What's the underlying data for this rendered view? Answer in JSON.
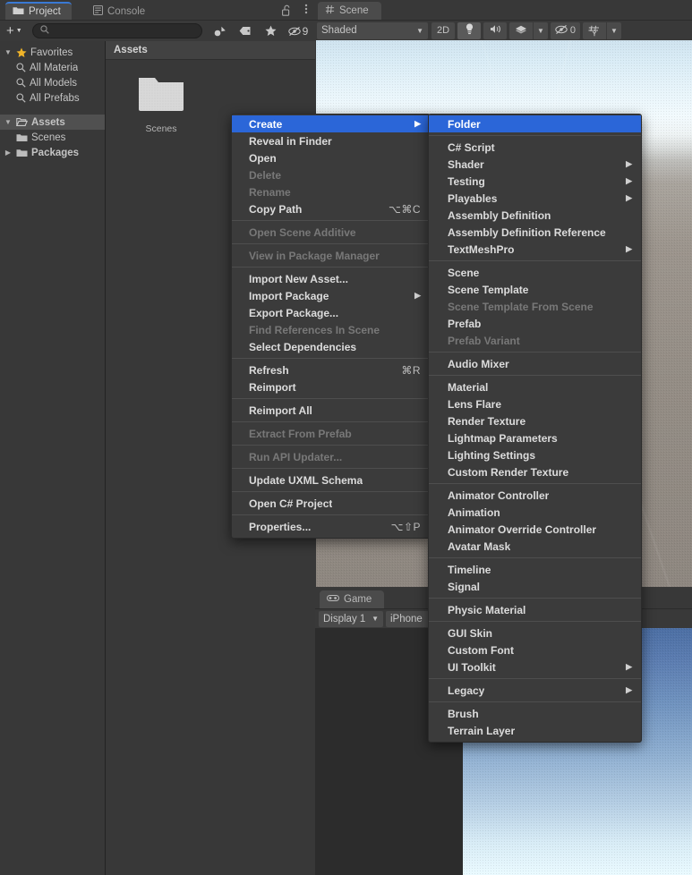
{
  "scene_view": {
    "tab_label": "Scene",
    "tab_icon": "grid-icon",
    "toolbar": {
      "shading_mode": "Shaded",
      "two_d_label": "2D",
      "lighting_icon": "lightbulb-icon",
      "audio_icon": "speaker-icon",
      "fx_icon": "effects-icon",
      "fx_dropdown_icon": "chevron-down-icon",
      "hidden_objects_icon": "eye-off-icon",
      "hidden_objects_count": "0",
      "grid_icon": "grid-visibility-icon",
      "grid_dropdown_icon": "chevron-down-icon",
      "dropdown_icon": "chevron-down-icon"
    }
  },
  "game_view": {
    "tab_label": "Game",
    "tab_icon": "gamepad-icon",
    "toolbar": {
      "display": "Display 1",
      "aspect": "iPhone",
      "dropdown_icon": "chevron-down-icon"
    }
  },
  "project_panel": {
    "tabs": [
      {
        "label": "Project",
        "icon": "folder-icon",
        "selected": true
      },
      {
        "label": "Console",
        "icon": "console-icon",
        "selected": false
      }
    ],
    "lock_icon": "lock-open-icon",
    "menu_icon": "kebab-menu-icon",
    "toolbar": {
      "add_label": "+",
      "add_dropdown_icon": "chevron-down-icon",
      "search_placeholder": "",
      "search_value": "",
      "search_icon": "search-icon",
      "filter_type_icon": "filter-by-type-icon",
      "filter_label_icon": "filter-by-label-icon",
      "favorites_icon": "star-icon",
      "hidden_icon": "eye-off-icon",
      "hidden_count": "9"
    },
    "tree": [
      {
        "label": "Favorites",
        "icon": "star-icon",
        "arrow": "expanded",
        "indent": 0,
        "selected": false,
        "dim": false
      },
      {
        "label": "All Materia",
        "icon": "search-icon",
        "arrow": "none",
        "indent": 1,
        "selected": false,
        "dim": false
      },
      {
        "label": "All Models",
        "icon": "search-icon",
        "arrow": "none",
        "indent": 1,
        "selected": false,
        "dim": false
      },
      {
        "label": "All Prefabs",
        "icon": "search-icon",
        "arrow": "none",
        "indent": 1,
        "selected": false,
        "dim": false
      },
      {
        "label": "Assets",
        "icon": "folder-open-icon",
        "arrow": "expanded",
        "indent": 0,
        "selected": true,
        "dim": false
      },
      {
        "label": "Scenes",
        "icon": "folder-icon",
        "arrow": "none",
        "indent": 1,
        "selected": false,
        "dim": false
      },
      {
        "label": "Packages",
        "icon": "folder-icon",
        "arrow": "collapsed",
        "indent": 0,
        "selected": false,
        "dim": false
      }
    ],
    "breadcrumb": "Assets",
    "assets": [
      {
        "name": "Scenes",
        "icon": "folder-icon"
      }
    ]
  },
  "context_menu": {
    "items": [
      {
        "label": "Create",
        "shortcut": "",
        "submenu": true,
        "disabled": false,
        "highlighted": true
      },
      {
        "label": "Reveal in Finder",
        "shortcut": "",
        "submenu": false,
        "disabled": false,
        "highlighted": false
      },
      {
        "label": "Open",
        "shortcut": "",
        "submenu": false,
        "disabled": false,
        "highlighted": false
      },
      {
        "label": "Delete",
        "shortcut": "",
        "submenu": false,
        "disabled": true,
        "highlighted": false
      },
      {
        "label": "Rename",
        "shortcut": "",
        "submenu": false,
        "disabled": true,
        "highlighted": false
      },
      {
        "label": "Copy Path",
        "shortcut": "⌥⌘C",
        "submenu": false,
        "disabled": false,
        "highlighted": false
      },
      {
        "separator": true
      },
      {
        "label": "Open Scene Additive",
        "shortcut": "",
        "submenu": false,
        "disabled": true,
        "highlighted": false
      },
      {
        "separator": true
      },
      {
        "label": "View in Package Manager",
        "shortcut": "",
        "submenu": false,
        "disabled": true,
        "highlighted": false
      },
      {
        "separator": true
      },
      {
        "label": "Import New Asset...",
        "shortcut": "",
        "submenu": false,
        "disabled": false,
        "highlighted": false
      },
      {
        "label": "Import Package",
        "shortcut": "",
        "submenu": true,
        "disabled": false,
        "highlighted": false
      },
      {
        "label": "Export Package...",
        "shortcut": "",
        "submenu": false,
        "disabled": false,
        "highlighted": false
      },
      {
        "label": "Find References In Scene",
        "shortcut": "",
        "submenu": false,
        "disabled": true,
        "highlighted": false
      },
      {
        "label": "Select Dependencies",
        "shortcut": "",
        "submenu": false,
        "disabled": false,
        "highlighted": false
      },
      {
        "separator": true
      },
      {
        "label": "Refresh",
        "shortcut": "⌘R",
        "submenu": false,
        "disabled": false,
        "highlighted": false
      },
      {
        "label": "Reimport",
        "shortcut": "",
        "submenu": false,
        "disabled": false,
        "highlighted": false
      },
      {
        "separator": true
      },
      {
        "label": "Reimport All",
        "shortcut": "",
        "submenu": false,
        "disabled": false,
        "highlighted": false
      },
      {
        "separator": true
      },
      {
        "label": "Extract From Prefab",
        "shortcut": "",
        "submenu": false,
        "disabled": true,
        "highlighted": false
      },
      {
        "separator": true
      },
      {
        "label": "Run API Updater...",
        "shortcut": "",
        "submenu": false,
        "disabled": true,
        "highlighted": false
      },
      {
        "separator": true
      },
      {
        "label": "Update UXML Schema",
        "shortcut": "",
        "submenu": false,
        "disabled": false,
        "highlighted": false
      },
      {
        "separator": true
      },
      {
        "label": "Open C# Project",
        "shortcut": "",
        "submenu": false,
        "disabled": false,
        "highlighted": false
      },
      {
        "separator": true
      },
      {
        "label": "Properties...",
        "shortcut": "⌥⇧P",
        "submenu": false,
        "disabled": false,
        "highlighted": false
      }
    ]
  },
  "create_submenu": {
    "items": [
      {
        "label": "Folder",
        "submenu": false,
        "disabled": false,
        "highlighted": true
      },
      {
        "separator": true
      },
      {
        "label": "C# Script",
        "submenu": false,
        "disabled": false,
        "highlighted": false
      },
      {
        "label": "Shader",
        "submenu": true,
        "disabled": false,
        "highlighted": false
      },
      {
        "label": "Testing",
        "submenu": true,
        "disabled": false,
        "highlighted": false
      },
      {
        "label": "Playables",
        "submenu": true,
        "disabled": false,
        "highlighted": false
      },
      {
        "label": "Assembly Definition",
        "submenu": false,
        "disabled": false,
        "highlighted": false
      },
      {
        "label": "Assembly Definition Reference",
        "submenu": false,
        "disabled": false,
        "highlighted": false
      },
      {
        "label": "TextMeshPro",
        "submenu": true,
        "disabled": false,
        "highlighted": false
      },
      {
        "separator": true
      },
      {
        "label": "Scene",
        "submenu": false,
        "disabled": false,
        "highlighted": false
      },
      {
        "label": "Scene Template",
        "submenu": false,
        "disabled": false,
        "highlighted": false
      },
      {
        "label": "Scene Template From Scene",
        "submenu": false,
        "disabled": true,
        "highlighted": false
      },
      {
        "label": "Prefab",
        "submenu": false,
        "disabled": false,
        "highlighted": false
      },
      {
        "label": "Prefab Variant",
        "submenu": false,
        "disabled": true,
        "highlighted": false
      },
      {
        "separator": true
      },
      {
        "label": "Audio Mixer",
        "submenu": false,
        "disabled": false,
        "highlighted": false
      },
      {
        "separator": true
      },
      {
        "label": "Material",
        "submenu": false,
        "disabled": false,
        "highlighted": false
      },
      {
        "label": "Lens Flare",
        "submenu": false,
        "disabled": false,
        "highlighted": false
      },
      {
        "label": "Render Texture",
        "submenu": false,
        "disabled": false,
        "highlighted": false
      },
      {
        "label": "Lightmap Parameters",
        "submenu": false,
        "disabled": false,
        "highlighted": false
      },
      {
        "label": "Lighting Settings",
        "submenu": false,
        "disabled": false,
        "highlighted": false
      },
      {
        "label": "Custom Render Texture",
        "submenu": false,
        "disabled": false,
        "highlighted": false
      },
      {
        "separator": true
      },
      {
        "label": "Animator Controller",
        "submenu": false,
        "disabled": false,
        "highlighted": false
      },
      {
        "label": "Animation",
        "submenu": false,
        "disabled": false,
        "highlighted": false
      },
      {
        "label": "Animator Override Controller",
        "submenu": false,
        "disabled": false,
        "highlighted": false
      },
      {
        "label": "Avatar Mask",
        "submenu": false,
        "disabled": false,
        "highlighted": false
      },
      {
        "separator": true
      },
      {
        "label": "Timeline",
        "submenu": false,
        "disabled": false,
        "highlighted": false
      },
      {
        "label": "Signal",
        "submenu": false,
        "disabled": false,
        "highlighted": false
      },
      {
        "separator": true
      },
      {
        "label": "Physic Material",
        "submenu": false,
        "disabled": false,
        "highlighted": false
      },
      {
        "separator": true
      },
      {
        "label": "GUI Skin",
        "submenu": false,
        "disabled": false,
        "highlighted": false
      },
      {
        "label": "Custom Font",
        "submenu": false,
        "disabled": false,
        "highlighted": false
      },
      {
        "label": "UI Toolkit",
        "submenu": true,
        "disabled": false,
        "highlighted": false
      },
      {
        "separator": true
      },
      {
        "label": "Legacy",
        "submenu": true,
        "disabled": false,
        "highlighted": false
      },
      {
        "separator": true
      },
      {
        "label": "Brush",
        "submenu": false,
        "disabled": false,
        "highlighted": false
      },
      {
        "label": "Terrain Layer",
        "submenu": false,
        "disabled": false,
        "highlighted": false
      }
    ]
  },
  "colors": {
    "accent_blue": "#2b66d8",
    "tab_accent": "#3a79d4",
    "panel_bg": "#383838",
    "menu_bg": "#3b3b3b",
    "star_yellow": "#f0b429"
  }
}
